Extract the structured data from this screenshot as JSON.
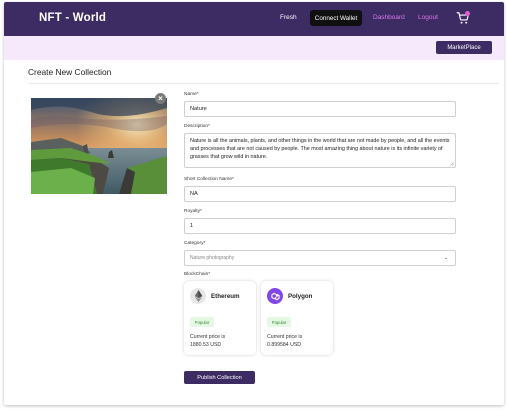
{
  "header": {
    "brand": "NFT - World",
    "nav_fresh": "Fresh",
    "connect_wallet": "Connect Wallet",
    "nav_dashboard": "Dashboard",
    "nav_logout": "Logout",
    "cart_icon": "shopping-cart-icon"
  },
  "subheader": {
    "marketplace_button": "MarketPlace"
  },
  "page": {
    "title": "Create New Collection"
  },
  "cover_image": {
    "remove_icon": "close-icon",
    "remove_symbol": "×"
  },
  "form": {
    "name": {
      "label": "Name",
      "required": "*",
      "value": "Nature"
    },
    "description": {
      "label": "Description",
      "required": "*",
      "value": "Nature is all the animals, plants, and other things in the world that are not made by people, and all the events and processes that are not caused by people. The most amazing thing about nature is its infinite variety of grasses that grow wild in nature."
    },
    "short_name": {
      "label": "Short Collection Name",
      "required": "*",
      "value": "NA"
    },
    "royalty": {
      "label": "Royalty",
      "required": "*",
      "value": "1"
    },
    "category": {
      "label": "Category",
      "required": "*",
      "placeholder": "Nature photography",
      "arrow": "⌄"
    },
    "blockchain": {
      "label": "BlockChain",
      "required": "*"
    }
  },
  "chains": [
    {
      "name": "Ethereum",
      "badge": "Popular",
      "price_label": "Current price is",
      "price": "1880.53 USD",
      "icon": "ethereum-icon",
      "color": "#e7e7e7"
    },
    {
      "name": "Polygon",
      "badge": "Popular",
      "price_label": "Current price is",
      "price": "0.899584 USD",
      "icon": "polygon-icon",
      "color": "#8247e5"
    }
  ],
  "publish_button": "Publish Collection",
  "colors": {
    "primary": "#3d2b64",
    "accent_pink": "#d879e9",
    "subbar": "#f6e9fb",
    "badge_green": "#3a8a3a"
  }
}
